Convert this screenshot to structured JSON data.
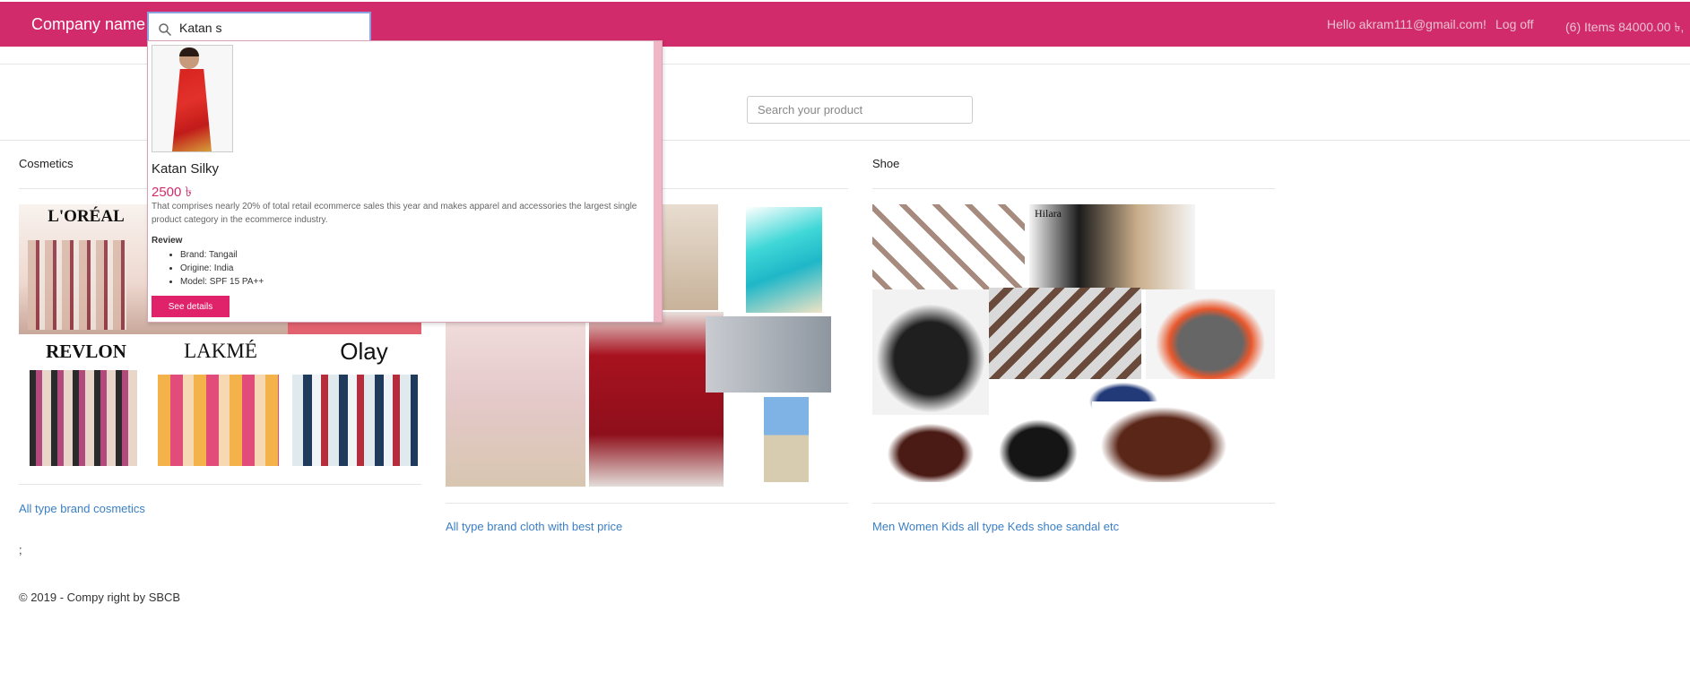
{
  "header": {
    "brand": "Company name",
    "search_value": "Katan s",
    "hello": "Hello akram111@gmail.com!",
    "logoff": "Log off",
    "cart": "(6) Items 84000.00 ৳,"
  },
  "main": {
    "search_placeholder": "Search your product",
    "columns": [
      {
        "title": "Cosmetics",
        "link": "All type brand cosmetics",
        "brands": [
          "L'ORÉAL",
          "REVLON",
          "LAKMÉ",
          "Olay"
        ]
      },
      {
        "title": "",
        "link": "All type brand cloth with best price"
      },
      {
        "title": "Shoe",
        "link": "Men Women Kids all type Keds shoe sandal etc",
        "brands": [
          "Hilara"
        ]
      }
    ],
    "semicolon": ";",
    "footer": "© 2019 - Compy right by SBCB"
  },
  "dropdown": {
    "product_name": "Katan Silky",
    "price": "2500 ৳",
    "description": "That comprises nearly 20% of total retail ecommerce sales this year and makes apparel and accessories the largest single product category in the ecommerce industry.",
    "review_label": "Review",
    "specs": [
      "Brand: Tangail",
      "Origine: India",
      "Model: SPF 15 PA++"
    ],
    "button_label": "See details"
  },
  "colors": {
    "brand": "#d12b6b",
    "link": "#3a7fc4",
    "button": "#e0226a"
  }
}
